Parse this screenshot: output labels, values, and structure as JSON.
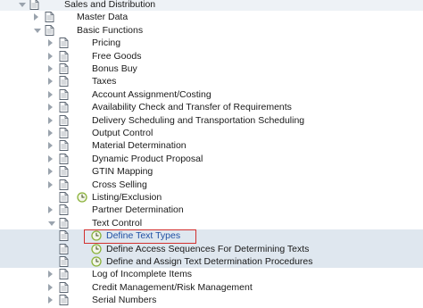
{
  "tree": {
    "rows": [
      {
        "label": "Sales and Distribution",
        "state": "expanded",
        "level": 0,
        "type": "folder"
      },
      {
        "label": "Master Data",
        "state": "collapsed",
        "level": 1,
        "type": "folder"
      },
      {
        "label": "Basic Functions",
        "state": "expanded",
        "level": 1,
        "type": "folder"
      },
      {
        "label": "Pricing",
        "state": "collapsed",
        "level": 2,
        "type": "folder"
      },
      {
        "label": "Free Goods",
        "state": "collapsed",
        "level": 2,
        "type": "folder"
      },
      {
        "label": "Bonus Buy",
        "state": "collapsed",
        "level": 2,
        "type": "folder"
      },
      {
        "label": "Taxes",
        "state": "collapsed",
        "level": 2,
        "type": "folder"
      },
      {
        "label": "Account Assignment/Costing",
        "state": "collapsed",
        "level": 2,
        "type": "folder"
      },
      {
        "label": "Availability Check and Transfer of Requirements",
        "state": "collapsed",
        "level": 2,
        "type": "folder"
      },
      {
        "label": "Delivery Scheduling and Transportation Scheduling",
        "state": "collapsed",
        "level": 2,
        "type": "folder"
      },
      {
        "label": "Output Control",
        "state": "collapsed",
        "level": 2,
        "type": "folder"
      },
      {
        "label": "Material Determination",
        "state": "collapsed",
        "level": 2,
        "type": "folder"
      },
      {
        "label": "Dynamic Product Proposal",
        "state": "collapsed",
        "level": 2,
        "type": "folder"
      },
      {
        "label": "GTIN Mapping",
        "state": "collapsed",
        "level": 2,
        "type": "folder"
      },
      {
        "label": "Cross Selling",
        "state": "collapsed",
        "level": 2,
        "type": "folder"
      },
      {
        "label": "Listing/Exclusion",
        "state": "leaf",
        "level": 2,
        "type": "activity"
      },
      {
        "label": "Partner Determination",
        "state": "collapsed",
        "level": 2,
        "type": "folder"
      },
      {
        "label": "Text Control",
        "state": "expanded",
        "level": 2,
        "type": "folder"
      },
      {
        "label": "Define Text Types",
        "state": "leaf",
        "level": 3,
        "type": "activity",
        "highlighted": true
      },
      {
        "label": "Define Access Sequences For Determining Texts",
        "state": "leaf",
        "level": 3,
        "type": "activity"
      },
      {
        "label": "Define and Assign Text Determination Procedures",
        "state": "leaf",
        "level": 3,
        "type": "activity"
      },
      {
        "label": "Log of Incomplete Items",
        "state": "collapsed",
        "level": 2,
        "type": "folder"
      },
      {
        "label": "Credit Management/Risk Management",
        "state": "collapsed",
        "level": 2,
        "type": "folder"
      },
      {
        "label": "Serial Numbers",
        "state": "collapsed",
        "level": 2,
        "type": "folder"
      }
    ]
  },
  "colors": {
    "highlight_border": "#d2302e",
    "link_text": "#1f4fa3",
    "execute_icon": "#8ab23a",
    "caret": "#9aa3ad"
  },
  "icons": {
    "folder_doc": "document-icon",
    "activity": "execute-clock-icon"
  }
}
